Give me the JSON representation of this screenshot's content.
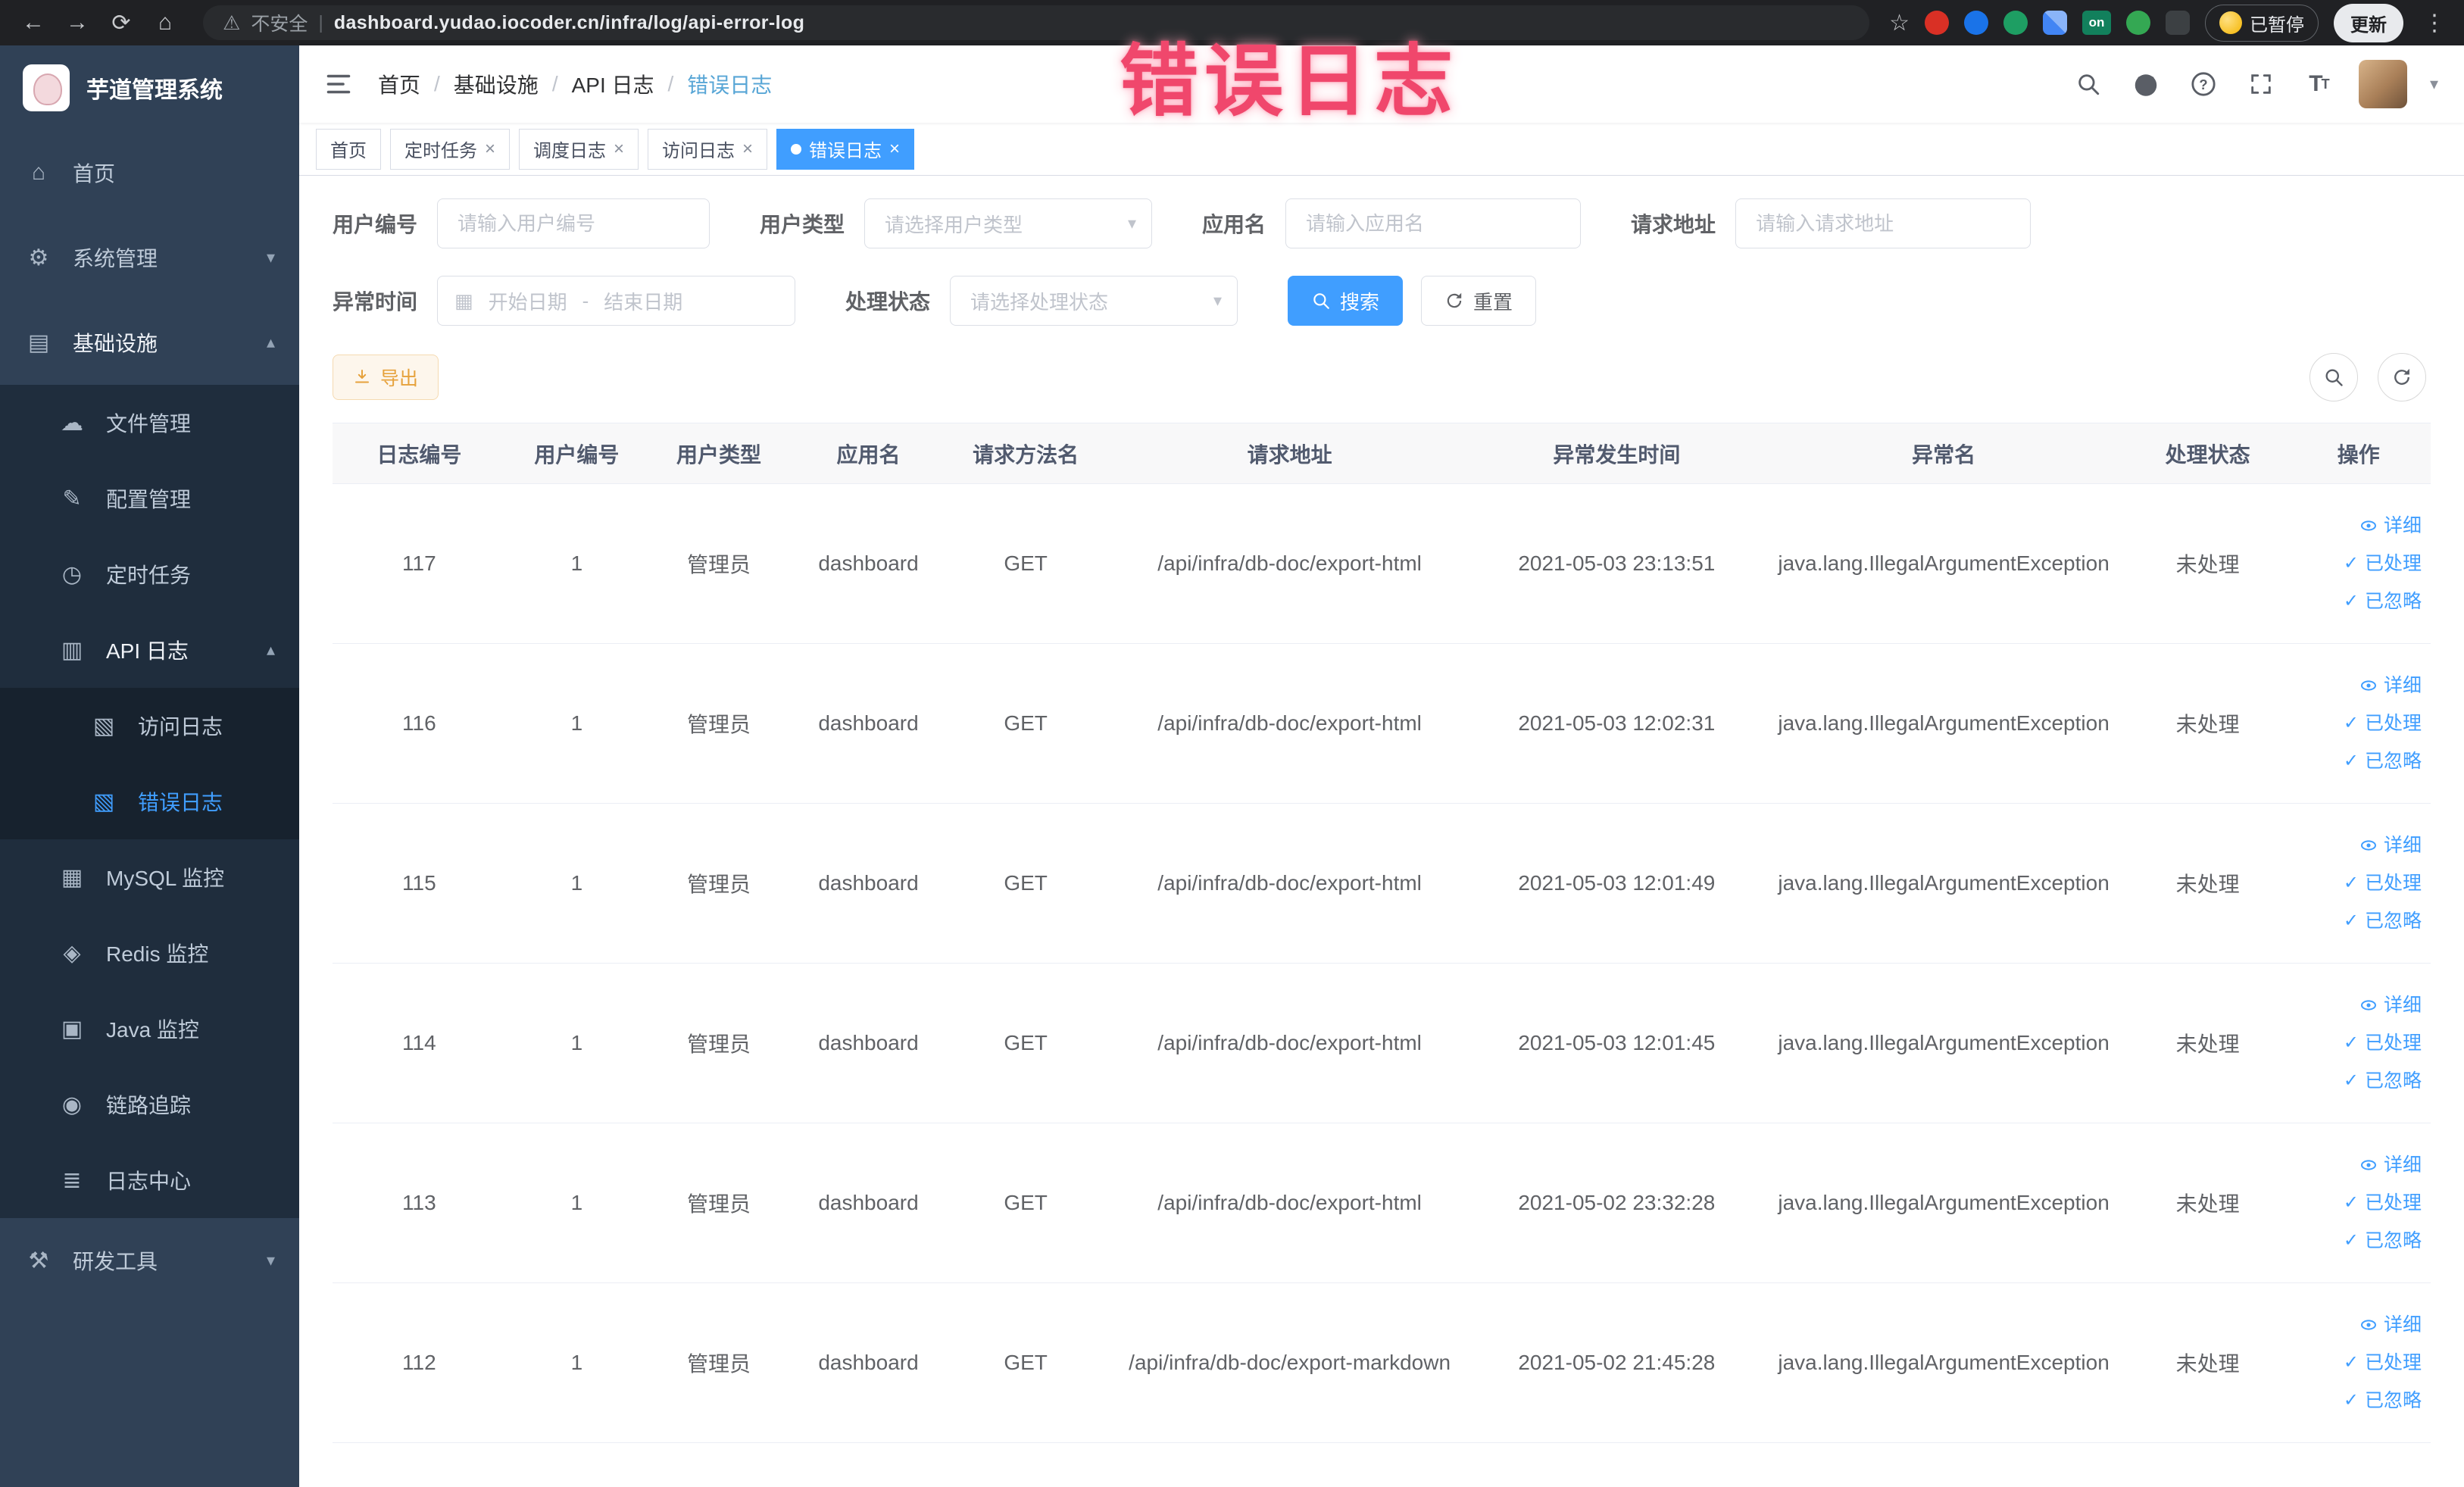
{
  "browser": {
    "security_label": "不安全",
    "url": "dashboard.yudao.iocoder.cn/infra/log/api-error-log",
    "paused_label": "已暂停",
    "update_label": "更新",
    "extension_on_badge": "on"
  },
  "watermark": "错误日志",
  "icons": {
    "back": "←",
    "forward": "→",
    "reload": "⟳",
    "home": "⌂",
    "warning": "⚠",
    "divider": "|",
    "star": "☆",
    "menu_dots": "⋮",
    "close": "×",
    "caret_down": "▾",
    "caret_up": "▴",
    "calendar": "▦",
    "check": "✓",
    "range_separator": "-",
    "breadcrumb_separator": "/"
  },
  "sidebar": {
    "logo_title": "芋道管理系统",
    "items": [
      {
        "label": "首页",
        "icon": "⌂"
      },
      {
        "label": "系统管理",
        "icon": "⚙"
      },
      {
        "label": "基础设施",
        "icon": "▤"
      },
      {
        "label": "文件管理",
        "icon": "☁"
      },
      {
        "label": "配置管理",
        "icon": "✎"
      },
      {
        "label": "定时任务",
        "icon": "◷"
      },
      {
        "label": "API 日志",
        "icon": "▥"
      },
      {
        "label": "访问日志",
        "icon": "▧"
      },
      {
        "label": "错误日志",
        "icon": "▧"
      },
      {
        "label": "MySQL 监控",
        "icon": "▦"
      },
      {
        "label": "Redis 监控",
        "icon": "◈"
      },
      {
        "label": "Java 监控",
        "icon": "▣"
      },
      {
        "label": "链路追踪",
        "icon": "◉"
      },
      {
        "label": "日志中心",
        "icon": "≣"
      },
      {
        "label": "研发工具",
        "icon": "⚒"
      }
    ]
  },
  "breadcrumb": [
    "首页",
    "基础设施",
    "API 日志",
    "错误日志"
  ],
  "tabs": [
    {
      "label": "首页"
    },
    {
      "label": "定时任务"
    },
    {
      "label": "调度日志"
    },
    {
      "label": "访问日志"
    },
    {
      "label": "错误日志"
    }
  ],
  "filters": {
    "user_id_label": "用户编号",
    "user_id_placeholder": "请输入用户编号",
    "user_type_label": "用户类型",
    "user_type_placeholder": "请选择用户类型",
    "app_name_label": "应用名",
    "app_name_placeholder": "请输入应用名",
    "request_url_label": "请求地址",
    "request_url_placeholder": "请输入请求地址",
    "exception_time_label": "异常时间",
    "start_placeholder": "开始日期",
    "end_placeholder": "结束日期",
    "process_status_label": "处理状态",
    "process_status_placeholder": "请选择处理状态",
    "search_label": "搜索",
    "reset_label": "重置"
  },
  "toolbar": {
    "export_label": "导出"
  },
  "table": {
    "columns": [
      "日志编号",
      "用户编号",
      "用户类型",
      "应用名",
      "请求方法名",
      "请求地址",
      "异常发生时间",
      "异常名",
      "处理状态",
      "操作"
    ],
    "actions": {
      "detail": "详细",
      "processed": "已处理",
      "ignored": "已忽略"
    },
    "rows": [
      {
        "id": "117",
        "user_id": "1",
        "user_type": "管理员",
        "app": "dashboard",
        "method": "GET",
        "url": "/api/infra/db-doc/export-html",
        "time": "2021-05-03 23:13:51",
        "exception": "java.lang.IllegalArgumentException",
        "status": "未处理"
      },
      {
        "id": "116",
        "user_id": "1",
        "user_type": "管理员",
        "app": "dashboard",
        "method": "GET",
        "url": "/api/infra/db-doc/export-html",
        "time": "2021-05-03 12:02:31",
        "exception": "java.lang.IllegalArgumentException",
        "status": "未处理"
      },
      {
        "id": "115",
        "user_id": "1",
        "user_type": "管理员",
        "app": "dashboard",
        "method": "GET",
        "url": "/api/infra/db-doc/export-html",
        "time": "2021-05-03 12:01:49",
        "exception": "java.lang.IllegalArgumentException",
        "status": "未处理"
      },
      {
        "id": "114",
        "user_id": "1",
        "user_type": "管理员",
        "app": "dashboard",
        "method": "GET",
        "url": "/api/infra/db-doc/export-html",
        "time": "2021-05-03 12:01:45",
        "exception": "java.lang.IllegalArgumentException",
        "status": "未处理"
      },
      {
        "id": "113",
        "user_id": "1",
        "user_type": "管理员",
        "app": "dashboard",
        "method": "GET",
        "url": "/api/infra/db-doc/export-html",
        "time": "2021-05-02 23:32:28",
        "exception": "java.lang.IllegalArgumentException",
        "status": "未处理"
      },
      {
        "id": "112",
        "user_id": "1",
        "user_type": "管理员",
        "app": "dashboard",
        "method": "GET",
        "url": "/api/infra/db-doc/export-markdown",
        "time": "2021-05-02 21:45:28",
        "exception": "java.lang.IllegalArgumentException",
        "status": "未处理"
      }
    ]
  }
}
